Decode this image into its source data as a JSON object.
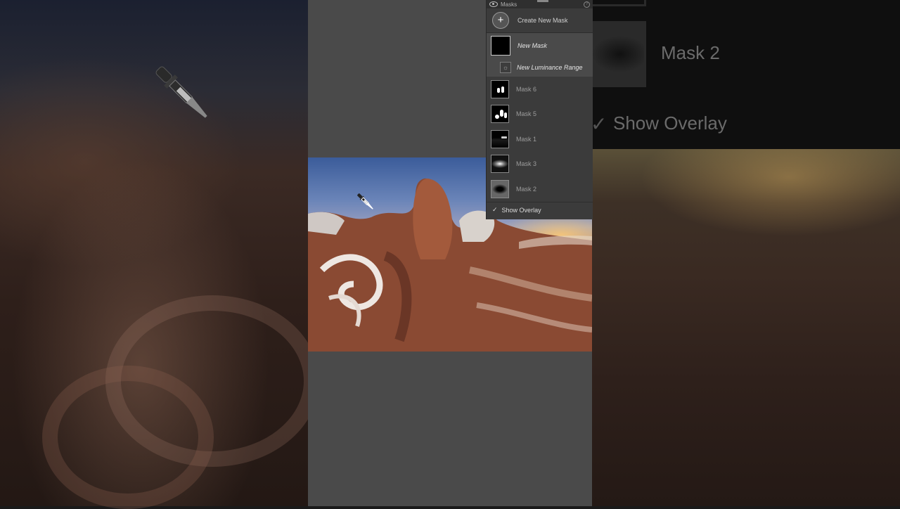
{
  "panel": {
    "title": "Masks",
    "create_label": "Create New Mask",
    "create_icon": "plus-icon",
    "new_mask_label": "New Mask",
    "new_luminance_label": "New Luminance Range",
    "masks": [
      {
        "label": "Mask 6"
      },
      {
        "label": "Mask 5"
      },
      {
        "label": "Mask 1"
      },
      {
        "label": "Mask 3"
      },
      {
        "label": "Mask 2"
      }
    ],
    "show_overlay_label": "Show Overlay",
    "show_overlay_checked": true
  },
  "background": {
    "zoom_mask_label": "Mask 2",
    "zoom_overlay_label": "Show Overlay"
  },
  "colors": {
    "panel_bg": "#3b3b3b",
    "canvas_bg": "#4a4a4a"
  }
}
